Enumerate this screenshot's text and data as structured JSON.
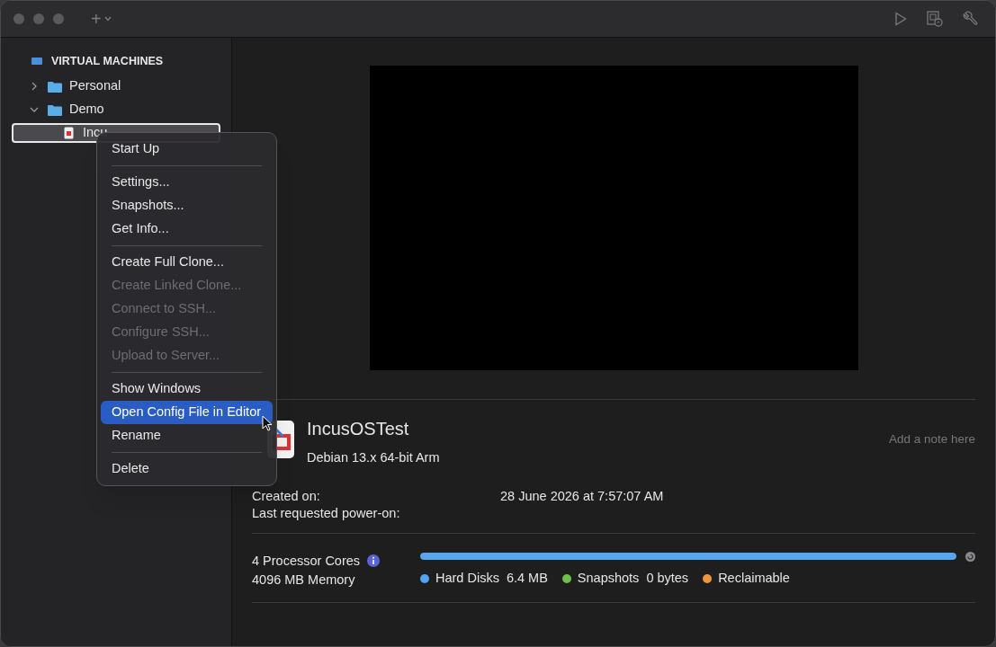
{
  "toolbar": {
    "add_label": "+"
  },
  "sidebar": {
    "section_title": "VIRTUAL MACHINES",
    "items": [
      {
        "label": "Personal",
        "expanded": false,
        "selected": false
      },
      {
        "label": "Demo",
        "expanded": true,
        "selected": false,
        "children": [
          {
            "label": "Incu",
            "selected": true
          }
        ]
      }
    ]
  },
  "context_menu": {
    "items": [
      {
        "kind": "item",
        "label": "Start Up",
        "disabled": false,
        "selected": false
      },
      {
        "kind": "separator"
      },
      {
        "kind": "item",
        "label": "Settings...",
        "disabled": false,
        "selected": false
      },
      {
        "kind": "item",
        "label": "Snapshots...",
        "disabled": false,
        "selected": false
      },
      {
        "kind": "item",
        "label": "Get Info...",
        "disabled": false,
        "selected": false
      },
      {
        "kind": "separator"
      },
      {
        "kind": "item",
        "label": "Create Full Clone...",
        "disabled": false,
        "selected": false
      },
      {
        "kind": "item",
        "label": "Create Linked Clone...",
        "disabled": true,
        "selected": false
      },
      {
        "kind": "item",
        "label": "Connect to SSH...",
        "disabled": true,
        "selected": false
      },
      {
        "kind": "item",
        "label": "Configure SSH...",
        "disabled": true,
        "selected": false
      },
      {
        "kind": "item",
        "label": "Upload to Server...",
        "disabled": true,
        "selected": false
      },
      {
        "kind": "separator"
      },
      {
        "kind": "item",
        "label": "Show Windows",
        "disabled": false,
        "selected": false
      },
      {
        "kind": "item",
        "label": "Open Config File in Editor",
        "disabled": false,
        "selected": true
      },
      {
        "kind": "item",
        "label": "Rename",
        "disabled": false,
        "selected": false
      },
      {
        "kind": "separator"
      },
      {
        "kind": "item",
        "label": "Delete",
        "disabled": false,
        "selected": false
      }
    ]
  },
  "vm": {
    "name": "IncusOSTest",
    "os": "Debian 13.x 64-bit Arm",
    "note": {
      "placeholder": "Add a note here"
    },
    "info": [
      {
        "label": "Created on:",
        "value": "28 June 2026 at 7:57:07 AM"
      },
      {
        "label": "Last requested power-on:"
      }
    ],
    "hardware": [
      "4 Processor Cores",
      "4096 MB Memory"
    ],
    "storage": {
      "level": 1,
      "legend": [
        {
          "label": "Hard Disks",
          "value": "6.4 MB",
          "color": "#4ea6f0"
        },
        {
          "label": "Snapshots",
          "value": "0 bytes",
          "color": "#6cc04a"
        },
        {
          "label": "Reclaimable",
          "color": "#f0963a"
        }
      ]
    }
  }
}
